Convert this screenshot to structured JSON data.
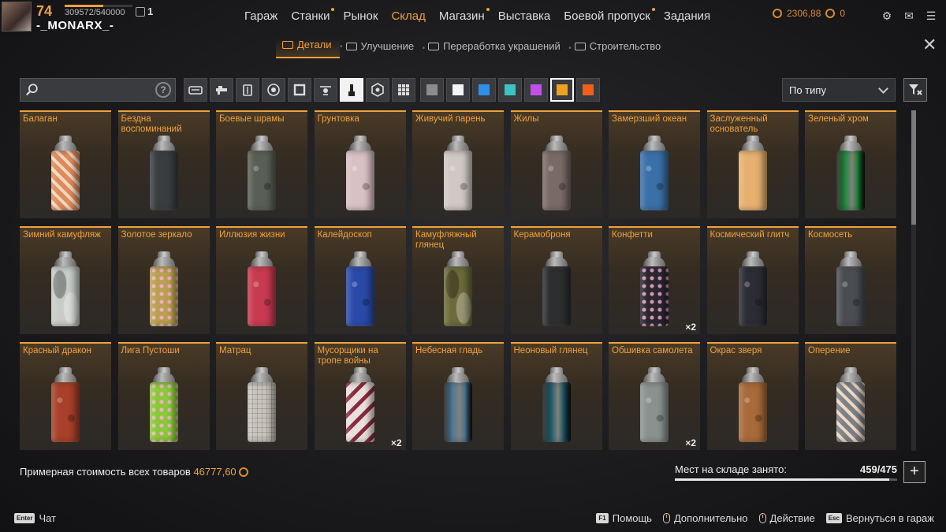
{
  "player": {
    "level": "74",
    "xp": "309572/540000",
    "xp_fraction": 0.573,
    "clan_rank": "1",
    "username": "-_MONARX_-"
  },
  "nav": {
    "items": [
      {
        "label": "Гараж",
        "active": false,
        "dot": false
      },
      {
        "label": "Станки",
        "active": false,
        "dot": true
      },
      {
        "label": "Рынок",
        "active": false,
        "dot": false
      },
      {
        "label": "Склад",
        "active": true,
        "dot": false
      },
      {
        "label": "Магазин",
        "active": false,
        "dot": true
      },
      {
        "label": "Выставка",
        "active": false,
        "dot": false
      },
      {
        "label": "Боевой пропуск",
        "active": false,
        "dot": true
      },
      {
        "label": "Задания",
        "active": false,
        "dot": false
      }
    ]
  },
  "currency": {
    "coins": "2306,88",
    "second": "0"
  },
  "subnav": {
    "tabs": [
      {
        "label": "Детали",
        "active": true
      },
      {
        "label": "Улучшение",
        "active": false
      },
      {
        "label": "Переработка украшений",
        "active": false
      },
      {
        "label": "Строительство",
        "active": false
      }
    ]
  },
  "search": {
    "placeholder": "",
    "help_label": "?"
  },
  "filters": {
    "icons": [
      "cabin-icon",
      "weapon-icon",
      "module-icon",
      "wheel-icon",
      "frame-icon",
      "drone-icon",
      "paint-icon",
      "sticker-icon",
      "grid-icon"
    ],
    "active_index": 6
  },
  "colors": {
    "swatches": [
      "#8c8c8c",
      "#f4f4f4",
      "#2f8fe8",
      "#3cc3c3",
      "#c050e8",
      "#f0a020",
      "#f06018"
    ],
    "active_index": 5
  },
  "sort": {
    "label": "По типу"
  },
  "items": [
    {
      "name": "Балаган",
      "qty": "",
      "color": "#e08a5a",
      "pattern": "stripes"
    },
    {
      "name": "Бездна воспоминаний",
      "qty": "",
      "color": "#3a3d40",
      "pattern": "plain"
    },
    {
      "name": "Боевые шрамы",
      "qty": "",
      "color": "#5a5f55",
      "pattern": "speckle"
    },
    {
      "name": "Грунтовка",
      "qty": "",
      "color": "#d8c0c4",
      "pattern": "speckle"
    },
    {
      "name": "Живучий парень",
      "qty": "",
      "color": "#cfc8c4",
      "pattern": "speckle"
    },
    {
      "name": "Жилы",
      "qty": "",
      "color": "#7a6a66",
      "pattern": "speckle"
    },
    {
      "name": "Замерзший океан",
      "qty": "",
      "color": "#3a70a8",
      "pattern": "speckle"
    },
    {
      "name": "Заслуженный основатель",
      "qty": "",
      "color": "#e8b070",
      "pattern": "plain"
    },
    {
      "name": "Зеленый хром",
      "qty": "",
      "color": "#1a8a3a",
      "pattern": "chrome"
    },
    {
      "name": "Зимний камуфляж",
      "qty": "",
      "color": "#c8ccc8",
      "pattern": "camo"
    },
    {
      "name": "Золотое зеркало",
      "qty": "",
      "color": "#b8a050",
      "pattern": "dots"
    },
    {
      "name": "Иллюзия жизни",
      "qty": "",
      "color": "#c83a50",
      "pattern": "speckle"
    },
    {
      "name": "Калейдоскоп",
      "qty": "",
      "color": "#2a4aa8",
      "pattern": "speckle"
    },
    {
      "name": "Камуфляжный глянец",
      "qty": "",
      "color": "#6a6a3a",
      "pattern": "camo"
    },
    {
      "name": "Керамоброня",
      "qty": "",
      "color": "#2c2e30",
      "pattern": "plain"
    },
    {
      "name": "Конфетти",
      "qty": "×2",
      "color": "#2a2630",
      "pattern": "dots"
    },
    {
      "name": "Космический глитч",
      "qty": "",
      "color": "#2c2c34",
      "pattern": "speckle"
    },
    {
      "name": "Космосеть",
      "qty": "",
      "color": "#4a4e52",
      "pattern": "speckle"
    },
    {
      "name": "Красный дракон",
      "qty": "",
      "color": "#a8402a",
      "pattern": "speckle"
    },
    {
      "name": "Лига Пустоши",
      "qty": "",
      "color": "#8ac83a",
      "pattern": "dots"
    },
    {
      "name": "Матрац",
      "qty": "",
      "color": "#c8c4bc",
      "pattern": "grid"
    },
    {
      "name": "Мусорщики на тропе войны",
      "qty": "×2",
      "color": "#e8e0dc",
      "pattern": "zigzag"
    },
    {
      "name": "Небесная гладь",
      "qty": "",
      "color": "#4a7a9a",
      "pattern": "chrome"
    },
    {
      "name": "Неоновый глянец",
      "qty": "",
      "color": "#1a5a6a",
      "pattern": "chrome"
    },
    {
      "name": "Обшивка самолета",
      "qty": "×2",
      "color": "#8a9290",
      "pattern": "speckle"
    },
    {
      "name": "Окрас зверя",
      "qty": "",
      "color": "#a86a3a",
      "pattern": "speckle"
    },
    {
      "name": "Оперение",
      "qty": "",
      "color": "#7a8088",
      "pattern": "stripes"
    }
  ],
  "footer": {
    "total_label": "Примерная стоимость всех товаров",
    "total_value": "46777,60",
    "storage_label": "Мест на складе занято:",
    "storage_count": "459/475",
    "storage_fraction": 0.966,
    "plus_label": "+"
  },
  "bottombar": {
    "chat_key": "Enter",
    "chat_label": "Чат",
    "hints": [
      {
        "key": "F1",
        "label": "Помощь",
        "type": "key"
      },
      {
        "key": "",
        "label": "Дополнительно",
        "type": "mouse"
      },
      {
        "key": "",
        "label": "Действие",
        "type": "mouse"
      },
      {
        "key": "Esc",
        "label": "Вернуться в гараж",
        "type": "key"
      }
    ]
  }
}
